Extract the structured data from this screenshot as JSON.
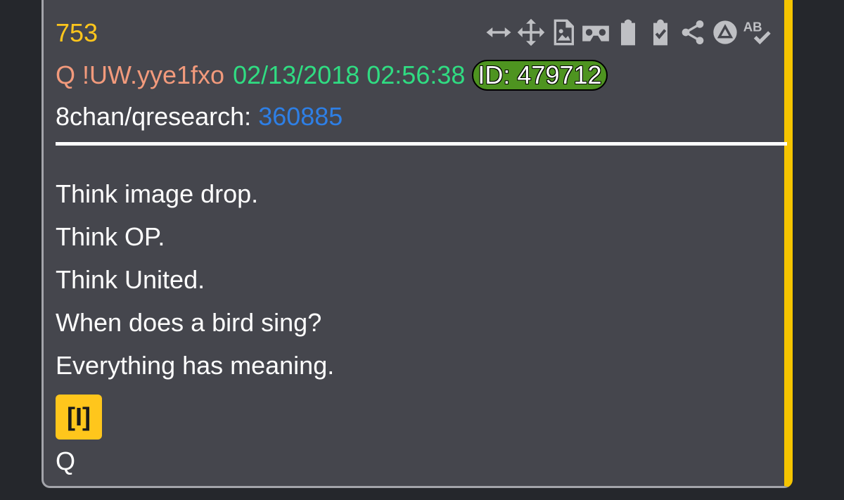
{
  "post": {
    "number": "753",
    "author": "Q !UW.yye1fxo",
    "date": "02/13/2018 02:56:38",
    "id": "ID: 479712",
    "board_label": "8chan/qresearch:",
    "board_post_link": "360885",
    "body_lines": [
      "Think image drop.",
      "Think OP.",
      "Think United.",
      "When does a bird sing?",
      "Everything has meaning."
    ],
    "tag": "[I]",
    "signature": "Q"
  },
  "toolbar": {
    "icons": [
      "expand-horizontal-icon",
      "move-icon",
      "image-file-icon",
      "vr-goggles-icon",
      "clipboard-icon",
      "clipboard-check-icon",
      "share-icon",
      "navigate-up-icon",
      "spellcheck-icon"
    ],
    "spellcheck_text": "AB"
  },
  "colors": {
    "background": "#25272c",
    "card": "#45464d",
    "accent_bar": "#f5c400",
    "post_number": "#ffc61c",
    "author": "#f29a7c",
    "date": "#30dc82",
    "id_badge": "#4e9420",
    "link": "#2e7fe5",
    "icon": "#bfc0c4"
  }
}
